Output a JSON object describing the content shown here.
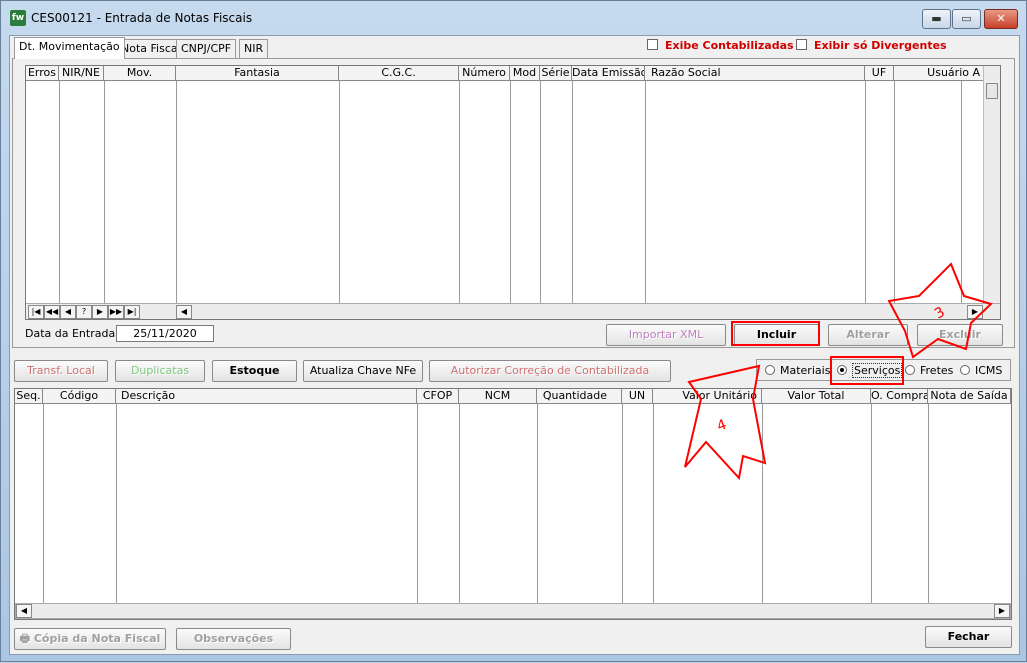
{
  "window": {
    "icon_text": "fw",
    "title": "CES00121 - Entrada de Notas Fiscais",
    "min_glyph": "▬",
    "max_glyph": "▭",
    "close_glyph": "✕"
  },
  "tabs": [
    {
      "label": "Dt. Movimentação",
      "active": true
    },
    {
      "label": "Nota Fiscal"
    },
    {
      "label": "CNPJ/CPF"
    },
    {
      "label": "NIR"
    }
  ],
  "filters": {
    "exibe_contabilizadas": "Exibe Contabilizadas",
    "exibir_divergentes": "Exibir só Divergentes"
  },
  "top_grid": {
    "columns": [
      "Erros",
      "NIR/NE",
      "Mov.",
      "Fantasia",
      "C.G.C.",
      "Número",
      "Mod",
      "Série",
      "Data Emissão",
      "Razão Social",
      "UF",
      "Usuário A"
    ],
    "nav_buttons": [
      "|◀",
      "◀◀",
      "◀",
      "?",
      "▶",
      "▶▶",
      "▶|"
    ],
    "scroll_left": "◀",
    "scroll_right": "▶"
  },
  "data_entrada": {
    "label": "Data da Entrada",
    "value": "25/11/2020"
  },
  "actions_top": {
    "importar_xml": "Importar XML",
    "incluir": "Incluir",
    "alterar": "Alterar",
    "excluir": "Excluir"
  },
  "actions_mid": {
    "transf_local": "Transf. Local",
    "duplicatas": "Duplicatas",
    "estoque": "Estoque",
    "atualiza_chave": "Atualiza Chave NFe",
    "autorizar_correcao": "Autorizar Correção de Contabilizada"
  },
  "radio_options": [
    {
      "label": "Materiais",
      "selected": false
    },
    {
      "label": "Serviços",
      "selected": true
    },
    {
      "label": "Fretes",
      "selected": false
    },
    {
      "label": "ICMS",
      "selected": false
    }
  ],
  "bottom_grid": {
    "columns": [
      "Seq.",
      "Código",
      "Descrição",
      "CFOP",
      "NCM",
      "Quantidade",
      "UN",
      "Valor Unitário",
      "Valor Total",
      "O. Compra",
      "Nota de Saída"
    ],
    "scroll_left": "◀",
    "scroll_right": "▶"
  },
  "footer": {
    "copia_nota": "Cópia da Nota Fiscal",
    "observacoes": "Observações",
    "fechar": "Fechar"
  },
  "annotations": {
    "arrow_3_label": "3",
    "arrow_4_label": "4",
    "color": "#ff0000"
  }
}
